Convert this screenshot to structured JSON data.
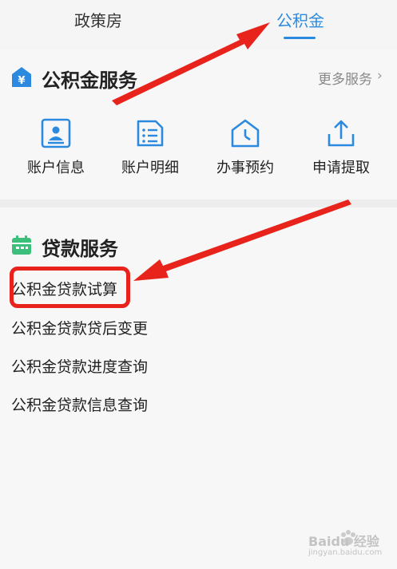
{
  "tabs": [
    {
      "label": "政策房",
      "active": false
    },
    {
      "label": "公积金",
      "active": true
    }
  ],
  "fund_service": {
    "title": "公积金服务",
    "more_label": "更多服务",
    "more_chevron": "›",
    "icon": "yuan-house-icon",
    "items": [
      {
        "label": "账户信息",
        "icon": "id-card-icon"
      },
      {
        "label": "账户明细",
        "icon": "list-document-icon"
      },
      {
        "label": "办事预约",
        "icon": "clock-house-icon"
      },
      {
        "label": "申请提取",
        "icon": "upload-icon"
      }
    ]
  },
  "loan_service": {
    "title": "贷款服务",
    "icon": "calendar-icon",
    "items": [
      {
        "label": "公积金贷款试算",
        "highlighted": true
      },
      {
        "label": "公积金贷款贷后变更",
        "highlighted": false
      },
      {
        "label": "公积金贷款进度查询",
        "highlighted": false
      },
      {
        "label": "公积金贷款信息查询",
        "highlighted": false
      }
    ]
  },
  "watermark": {
    "brand": "Baidu 经验",
    "url": "jingyan.baidu.com"
  },
  "colors": {
    "accent": "#2b8ae0",
    "annotation_red": "#e8231c",
    "loan_icon_green": "#3cbf7a"
  }
}
